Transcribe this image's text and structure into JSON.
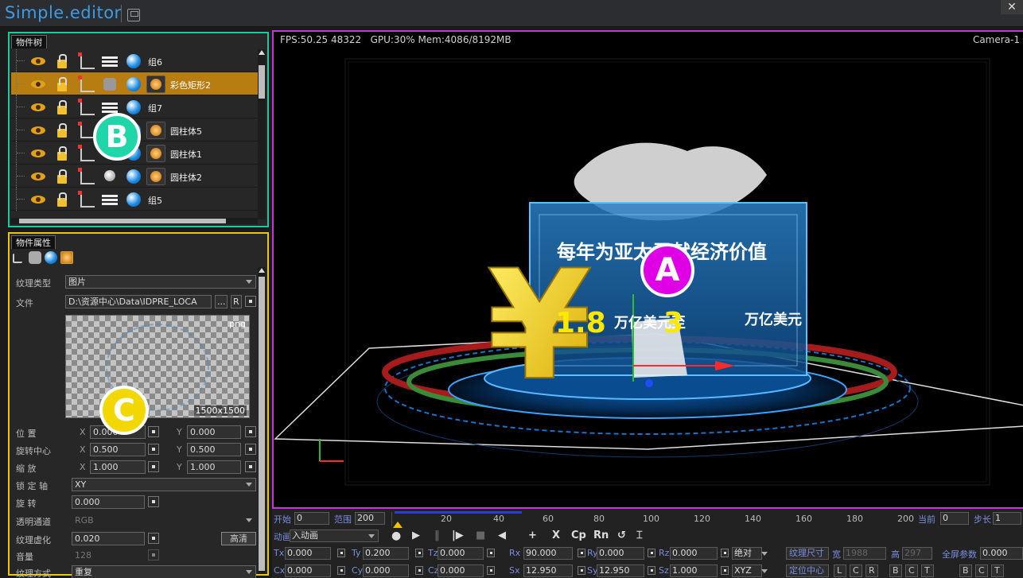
{
  "app": {
    "title": "Simple.editor",
    "close": "✕"
  },
  "tree": {
    "tab": "物件树",
    "nodes": [
      {
        "label": "组6",
        "kind": "group",
        "selected": false
      },
      {
        "label": "彩色矩形2",
        "kind": "rect",
        "selected": true
      },
      {
        "label": "组7",
        "kind": "group",
        "selected": false
      },
      {
        "label": "圆柱体5",
        "kind": "cyl",
        "selected": false
      },
      {
        "label": "圆柱体1",
        "kind": "cyl",
        "selected": false
      },
      {
        "label": "圆柱体2",
        "kind": "cyl",
        "selected": false
      },
      {
        "label": "组5",
        "kind": "group",
        "selected": false
      }
    ]
  },
  "props": {
    "tab": "物件属性",
    "texture_type_label": "纹理类型",
    "texture_type_value": "图片",
    "file_label": "文件",
    "file_value": "D:\\资源中心\\Data\\IDPRE_LOCA",
    "file_btn": "...",
    "file_r": "R",
    "preview_format": "png",
    "preview_size": "1500x1500",
    "position_label": "位 置",
    "pos_x": "0.000",
    "pos_y": "0.000",
    "rot_center_label": "旋转中心",
    "rc_x": "0.500",
    "rc_y": "0.500",
    "scale_label": "缩 放",
    "sc_x": "1.000",
    "sc_y": "1.000",
    "x_label": "X",
    "y_label": "Y",
    "lock_axis_label": "锁 定 轴",
    "lock_axis_value": "XY",
    "rotate_label": "旋 转",
    "rotate_value": "0.000",
    "alpha_label": "透明通道",
    "alpha_value": "RGB",
    "blur_label": "纹理虚化",
    "blur_value": "0.020",
    "blur_btn": "高清",
    "volume_label": "音量",
    "volume_value": "128",
    "tex_mode_label": "纹理方式",
    "tex_mode_value": "重复"
  },
  "viewport": {
    "fps": "FPS:50.25  48322",
    "gpu": "GPU:30% Mem:4086/8192MB",
    "camera": "Camera-1",
    "scene_title": "每年为亚太贡献经济价值",
    "scene_num1": "1.8",
    "scene_text1": "万亿美元至",
    "scene_num2": "3",
    "scene_text2": "万亿美元",
    "yen": "¥"
  },
  "markers": {
    "a": "A",
    "b": "B",
    "c": "C"
  },
  "timeline": {
    "start_label": "开始",
    "start_value": "0",
    "range_label": "范围",
    "range_value": "200",
    "current_label": "当前",
    "current_value": "0",
    "step_label": "步长",
    "step_value": "1",
    "ticks": [
      "20",
      "40",
      "60",
      "80",
      "100",
      "120",
      "140",
      "160",
      "180",
      "200"
    ],
    "anim_label": "动画",
    "anim_value": "入动画",
    "tools": [
      "+",
      "X",
      "Cp",
      "Rn",
      "↺"
    ],
    "tx_label": "Tx",
    "tx": "0.000",
    "ty_label": "Ty",
    "ty": "0.200",
    "tz_label": "Tz",
    "tz": "0.000",
    "rx_label": "Rx",
    "rx": "90.000",
    "ry_label": "Ry",
    "ry": "0.000",
    "rz_label": "Rz",
    "rz": "0.000",
    "abs_value": "绝对",
    "cx_label": "Cx",
    "cx": "0.000",
    "cy_label": "Cy",
    "cy": "0.000",
    "cz_label": "Cz",
    "cz": "0.000",
    "sx_label": "Sx",
    "sx": "12.950",
    "sy_label": "Sy",
    "sy": "12.950",
    "sz_label": "Sz",
    "sz": "1.000",
    "order_value": "XYZ",
    "tex_size_btn": "纹理尺寸",
    "width_label": "宽",
    "width_value": "1988",
    "height_label": "高",
    "height_value": "297",
    "fullscreen_label": "全屏参数",
    "fullscreen_value": "0.000",
    "locate_btn": "定位中心",
    "align_btns": [
      "L",
      "C",
      "R",
      "B",
      "C",
      "T",
      "B",
      "C",
      "T"
    ]
  },
  "colors": {
    "accent": "#3d9ce6",
    "tree_border": "#22c7a0",
    "props_border": "#e7c718",
    "viewport_border": "#c437d6",
    "selected_row": "#b87d10"
  }
}
